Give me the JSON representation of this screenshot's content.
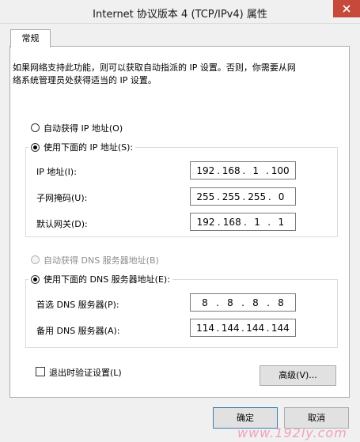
{
  "window": {
    "title": "Internet 协议版本 4 (TCP/IPv4) 属性"
  },
  "tab": {
    "label": "常规"
  },
  "description": {
    "line1": "如果网络支持此功能，则可以获取自动指派的 IP 设置。否则，你需要从网",
    "line2": "络系统管理员处获得适当的 IP 设置。"
  },
  "ip": {
    "auto_label": "自动获得 IP 地址(O)",
    "manual_label": "使用下面的 IP 地址(S):",
    "fields": [
      {
        "label": "IP 地址(I):",
        "octets": [
          "192",
          "168",
          "1",
          "100"
        ]
      },
      {
        "label": "子网掩码(U):",
        "octets": [
          "255",
          "255",
          "255",
          "0"
        ]
      },
      {
        "label": "默认网关(D):",
        "octets": [
          "192",
          "168",
          "1",
          "1"
        ]
      }
    ]
  },
  "dns": {
    "auto_label": "自动获得 DNS 服务器地址(B)",
    "manual_label": "使用下面的 DNS 服务器地址(E):",
    "fields": [
      {
        "label": "首选 DNS 服务器(P):",
        "octets": [
          "8",
          "8",
          "8",
          "8"
        ]
      },
      {
        "label": "备用 DNS 服务器(A):",
        "octets": [
          "114",
          "144",
          "144",
          "144"
        ]
      }
    ]
  },
  "validate_label": "退出时验证设置(L)",
  "buttons": {
    "advanced": "高级(V)...",
    "ok": "确定",
    "cancel": "取消"
  },
  "watermark": "www.192ly.com"
}
